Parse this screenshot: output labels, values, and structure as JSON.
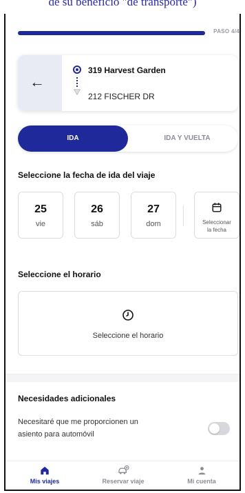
{
  "caption": "de su beneficio \"de transporte\")",
  "progress": {
    "label": "PASO 4/4",
    "fraction": 1.0
  },
  "route": {
    "origin": "319 Harvest Garden",
    "destination": "212 FISCHER DR"
  },
  "trip_type": {
    "options": [
      "IDA",
      "IDA Y VUELTA"
    ],
    "selected": "IDA"
  },
  "date_section": {
    "title": "Seleccione la fecha de ida del viaje",
    "dates": [
      {
        "num": "25",
        "day": "vie"
      },
      {
        "num": "26",
        "day": "sáb"
      },
      {
        "num": "27",
        "day": "dom"
      }
    ],
    "picker_label_1": "Seleccionar",
    "picker_label_2": "la fecha"
  },
  "time_section": {
    "title": "Seleccione el horario",
    "button_label": "Seleccione el horario"
  },
  "needs": {
    "title": "Necesidades adicionales",
    "car_seat_line1": "Necesitaré que me proporcionen un",
    "car_seat_line2": "asiento para automóvil",
    "car_seat_enabled": false
  },
  "bottom_nav": {
    "items": [
      {
        "label": "Mis viajes",
        "icon": "home-icon",
        "active": true
      },
      {
        "label": "Reservar viaje",
        "icon": "car-plus-icon",
        "active": false
      },
      {
        "label": "Mi cuenta",
        "icon": "person-icon",
        "active": false
      }
    ]
  },
  "colors": {
    "primary": "#20299a",
    "muted": "#8c8c96",
    "toggle_off": "#d8d8dc",
    "back_panel": "#e9ebf4"
  }
}
